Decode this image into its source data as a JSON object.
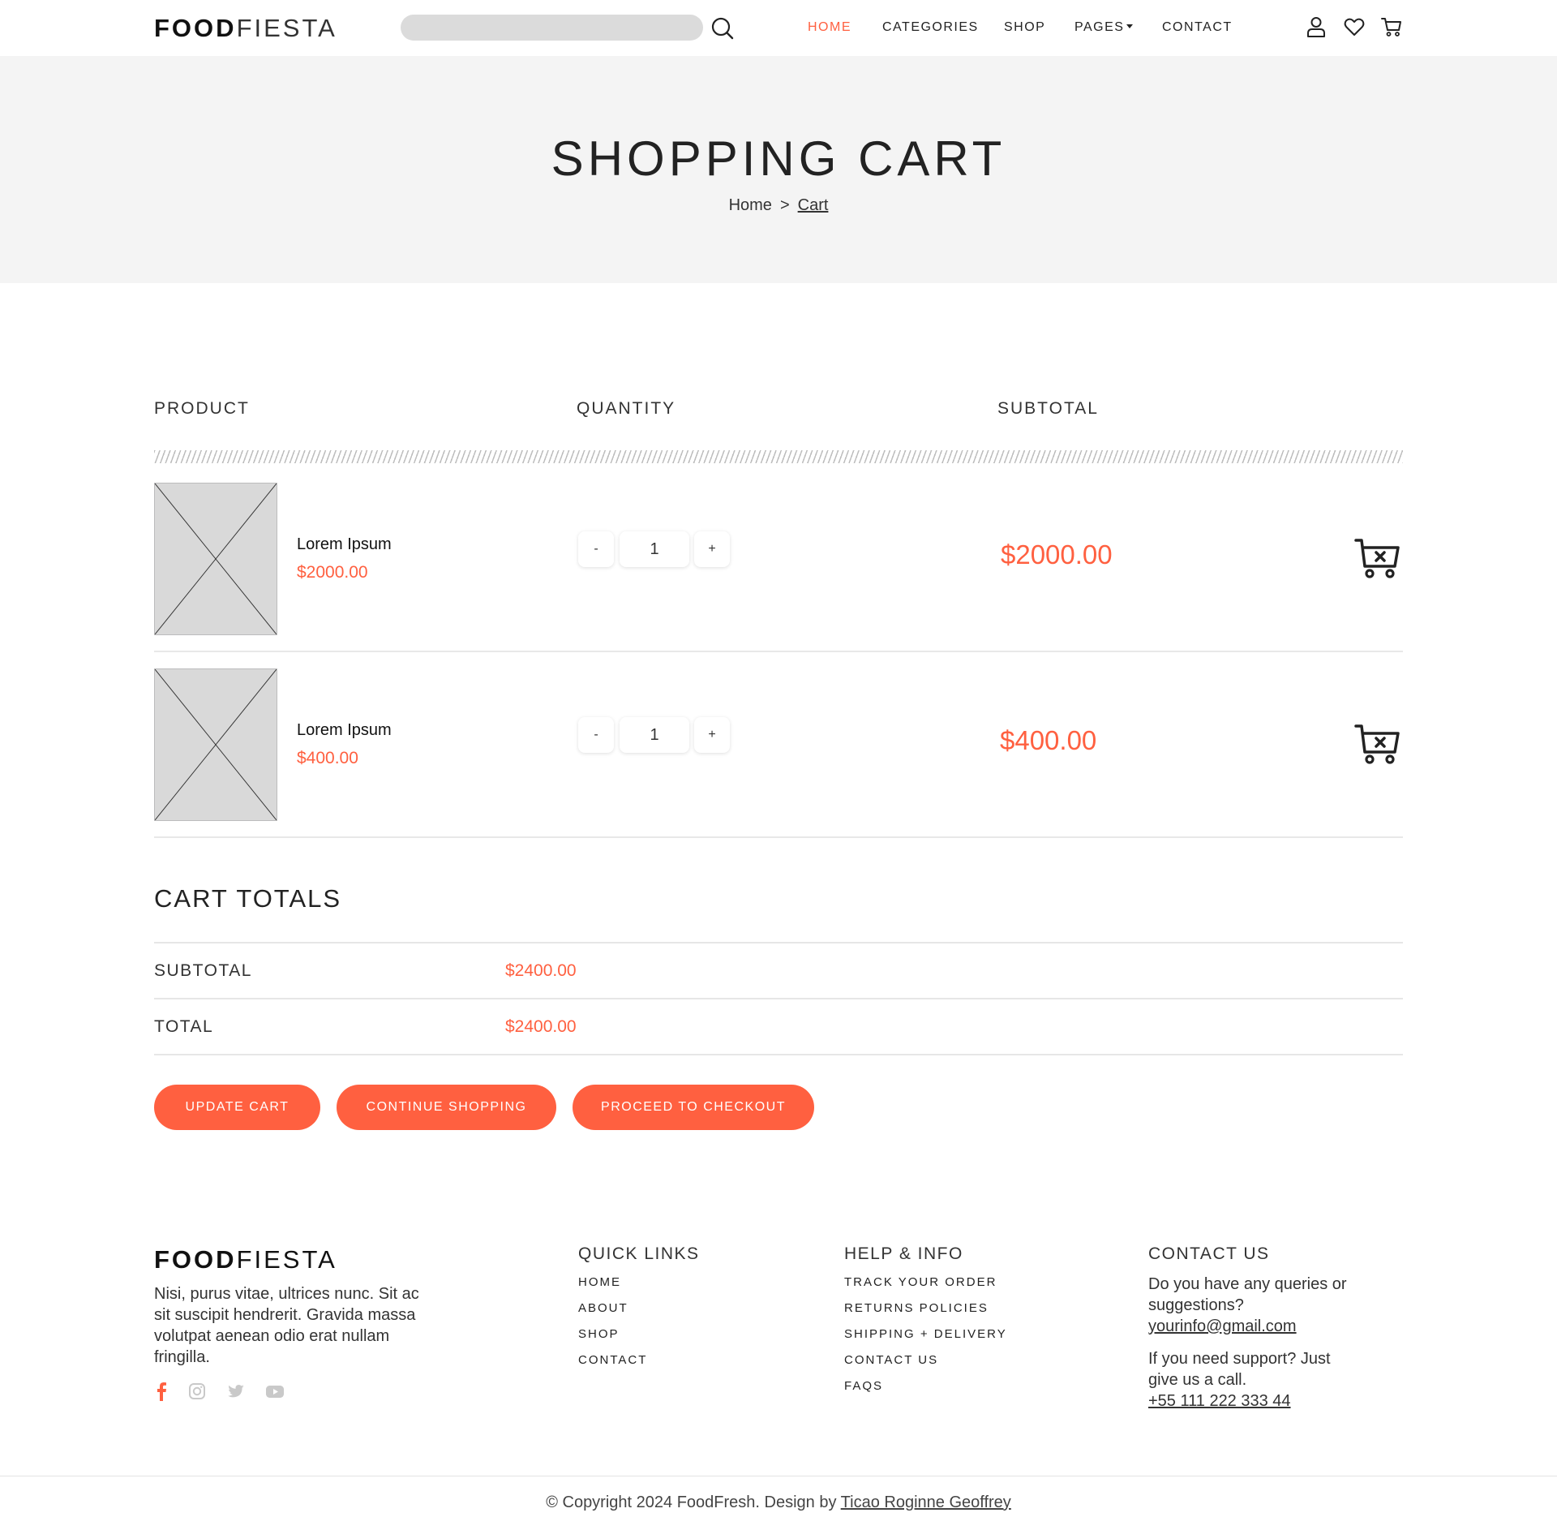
{
  "brand": {
    "bold": "FOOD",
    "light": "FIESTA",
    "accent_color": "#ff6040"
  },
  "header": {
    "search_placeholder": "",
    "nav": [
      {
        "label": "HOME",
        "active": true
      },
      {
        "label": "CATEGORIES",
        "active": false
      },
      {
        "label": "SHOP",
        "active": false
      },
      {
        "label": "PAGES",
        "active": false
      },
      {
        "label": "CONTACT",
        "active": false
      }
    ],
    "icons": [
      "search-icon",
      "user-icon",
      "heart-icon",
      "cart-icon"
    ]
  },
  "hero": {
    "title": "SHOPPING CART",
    "breadcrumb": {
      "home": "Home",
      "separator": ">",
      "current": "Cart"
    }
  },
  "cart": {
    "columns": {
      "product": "PRODUCT",
      "quantity": "QUANTITY",
      "subtotal": "SUBTOTAL"
    },
    "items": [
      {
        "name": "Lorem Ipsum",
        "price": "$2000.00",
        "quantity": "1",
        "subtotal": "$2000.00"
      },
      {
        "name": "Lorem Ipsum",
        "price": "$400.00",
        "quantity": "1",
        "subtotal": "$400.00"
      }
    ],
    "qty_minus": "-",
    "qty_plus": "+"
  },
  "totals": {
    "title": "CART TOTALS",
    "subtotal_label": "SUBTOTAL",
    "subtotal_value": "$2400.00",
    "total_label": "TOTAL",
    "total_value": "$2400.00"
  },
  "actions": {
    "update": "UPDATE CART",
    "continue": "CONTINUE SHOPPING",
    "checkout": "PROCEED TO CHECKOUT"
  },
  "footer": {
    "description": "Nisi, purus vitae, ultrices nunc. Sit ac sit suscipit hendrerit. Gravida massa volutpat aenean odio erat nullam fringilla.",
    "social": [
      "facebook-icon",
      "instagram-icon",
      "twitter-icon",
      "youtube-icon"
    ],
    "quick_links": {
      "title": "QUICK LINKS",
      "links": [
        "HOME",
        "ABOUT",
        "SHOP",
        "CONTACT"
      ]
    },
    "help_info": {
      "title": "HELP & INFO",
      "links": [
        "TRACK YOUR ORDER",
        "RETURNS POLICIES",
        "SHIPPING + DELIVERY",
        "CONTACT US",
        "FAQS"
      ]
    },
    "contact": {
      "title": "CONTACT US",
      "queries_text": "Do you have any queries or suggestions?",
      "email": "yourinfo@gmail.com",
      "support_text": "If you need support? Just give us a call.",
      "phone": "+55 111 222 333 44"
    },
    "copyright_prefix": "© Copyright 2024 FoodFresh. Design by",
    "copyright_author": "Ticao Roginne Geoffrey"
  }
}
